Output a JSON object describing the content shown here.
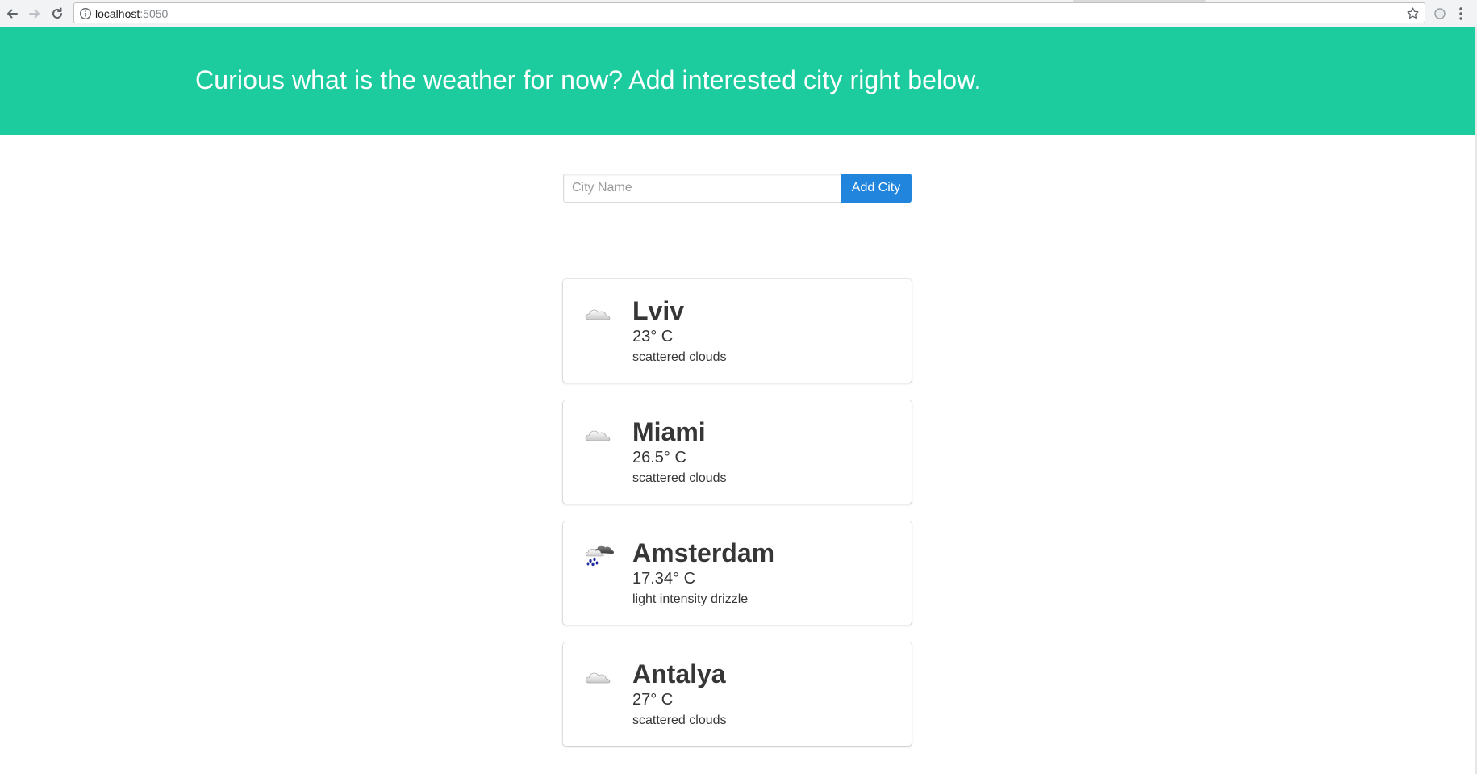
{
  "browser": {
    "url_host": "localhost",
    "url_port": ":5050"
  },
  "hero": {
    "title": "Curious what is the weather for now? Add interested city right below."
  },
  "form": {
    "placeholder": "City Name",
    "value": "",
    "button_label": "Add City"
  },
  "colors": {
    "hero_bg": "#1ccb9e",
    "button_bg": "#2185de"
  },
  "cities": [
    {
      "name": "Lviv",
      "temp": "23° C",
      "description": "scattered clouds",
      "icon": "cloud-icon"
    },
    {
      "name": "Miami",
      "temp": "26.5° C",
      "description": "scattered clouds",
      "icon": "cloud-icon"
    },
    {
      "name": "Amsterdam",
      "temp": "17.34° C",
      "description": "light intensity drizzle",
      "icon": "drizzle-icon"
    },
    {
      "name": "Antalya",
      "temp": "27° C",
      "description": "scattered clouds",
      "icon": "cloud-icon"
    }
  ]
}
